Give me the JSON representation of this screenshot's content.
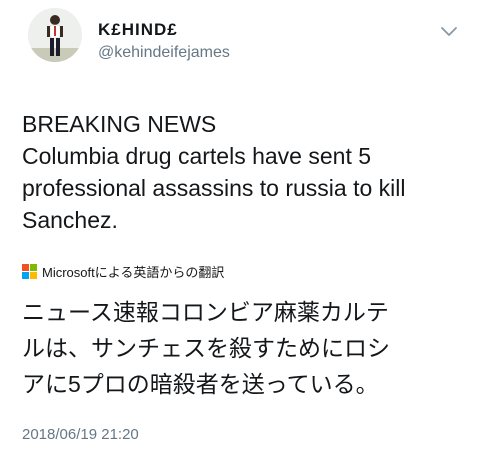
{
  "user": {
    "display_name": "K£HIND£",
    "handle": "@kehindeifejames"
  },
  "tweet": {
    "lines": [
      "BREAKING NEWS",
      "Columbia drug cartels have sent 5",
      "professional assassins to russia to kill",
      "Sanchez."
    ]
  },
  "translation": {
    "label": "Microsoftによる英語からの翻訳",
    "lines": [
      "ニュース速報コロンビア麻薬カルテ",
      "ルは、サンチェスを殺すためにロシ",
      "アに5プロの暗殺者を送っている。"
    ],
    "logo_colors": [
      "#f25022",
      "#7fba00",
      "#00a4ef",
      "#ffb900"
    ]
  },
  "timestamp": "2018/06/19 21:20",
  "icons": {
    "menu": "chevron-down-icon",
    "brand": "microsoft-logo-icon"
  }
}
